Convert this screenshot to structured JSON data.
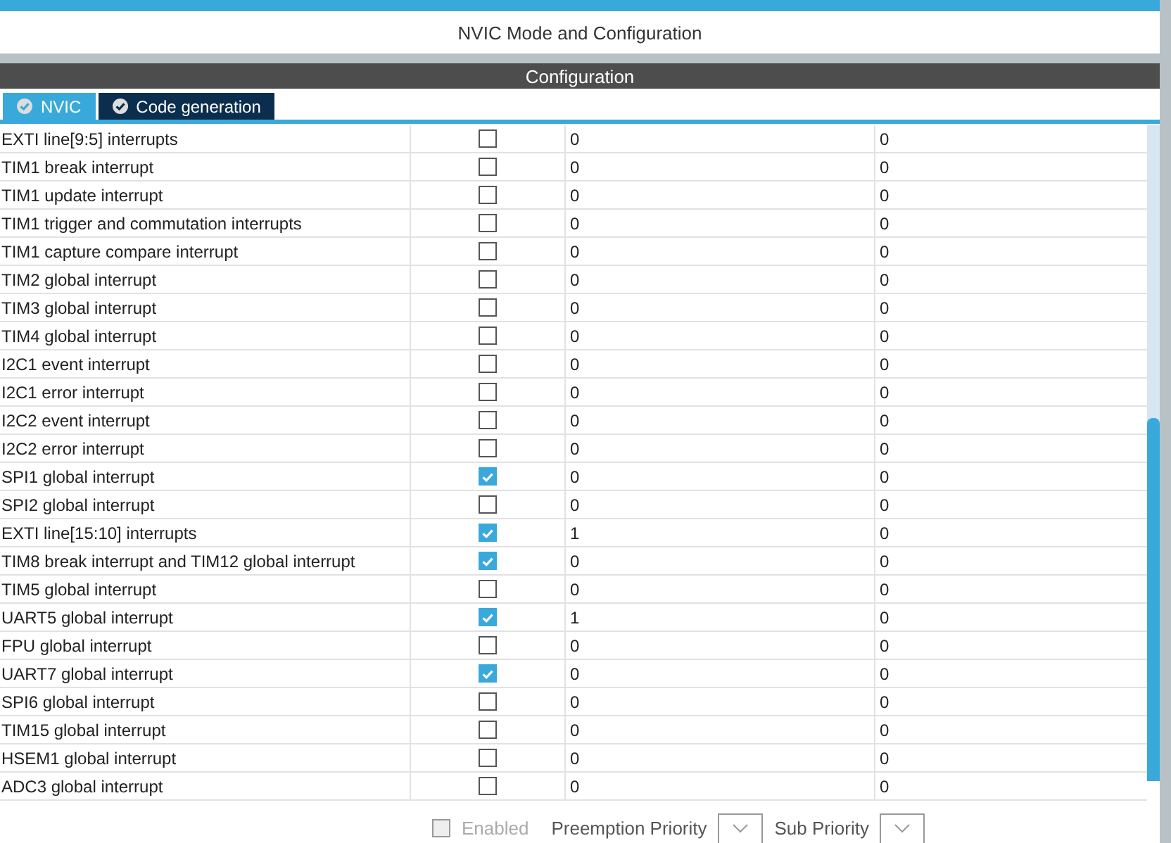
{
  "panel_title": "NVIC Mode and Configuration",
  "section_title": "Configuration",
  "tabs": [
    {
      "label": "NVIC",
      "selected": true
    },
    {
      "label": "Code generation",
      "selected": false
    }
  ],
  "rows": [
    {
      "name": "EXTI line[9:5] interrupts",
      "enabled": false,
      "preemption": "0",
      "sub": "0"
    },
    {
      "name": "TIM1 break interrupt",
      "enabled": false,
      "preemption": "0",
      "sub": "0"
    },
    {
      "name": "TIM1 update interrupt",
      "enabled": false,
      "preemption": "0",
      "sub": "0"
    },
    {
      "name": "TIM1 trigger and commutation interrupts",
      "enabled": false,
      "preemption": "0",
      "sub": "0"
    },
    {
      "name": "TIM1 capture compare interrupt",
      "enabled": false,
      "preemption": "0",
      "sub": "0"
    },
    {
      "name": "TIM2 global interrupt",
      "enabled": false,
      "preemption": "0",
      "sub": "0"
    },
    {
      "name": "TIM3 global interrupt",
      "enabled": false,
      "preemption": "0",
      "sub": "0"
    },
    {
      "name": "TIM4 global interrupt",
      "enabled": false,
      "preemption": "0",
      "sub": "0"
    },
    {
      "name": "I2C1 event interrupt",
      "enabled": false,
      "preemption": "0",
      "sub": "0"
    },
    {
      "name": "I2C1 error interrupt",
      "enabled": false,
      "preemption": "0",
      "sub": "0"
    },
    {
      "name": "I2C2 event interrupt",
      "enabled": false,
      "preemption": "0",
      "sub": "0"
    },
    {
      "name": "I2C2 error interrupt",
      "enabled": false,
      "preemption": "0",
      "sub": "0"
    },
    {
      "name": "SPI1 global interrupt",
      "enabled": true,
      "preemption": "0",
      "sub": "0"
    },
    {
      "name": "SPI2 global interrupt",
      "enabled": false,
      "preemption": "0",
      "sub": "0"
    },
    {
      "name": "EXTI line[15:10] interrupts",
      "enabled": true,
      "preemption": "1",
      "sub": "0"
    },
    {
      "name": "TIM8 break interrupt and TIM12 global interrupt",
      "enabled": true,
      "preemption": "0",
      "sub": "0"
    },
    {
      "name": "TIM5 global interrupt",
      "enabled": false,
      "preemption": "0",
      "sub": "0"
    },
    {
      "name": "UART5 global interrupt",
      "enabled": true,
      "preemption": "1",
      "sub": "0"
    },
    {
      "name": "FPU global interrupt",
      "enabled": false,
      "preemption": "0",
      "sub": "0"
    },
    {
      "name": "UART7 global interrupt",
      "enabled": true,
      "preemption": "0",
      "sub": "0"
    },
    {
      "name": "SPI6 global interrupt",
      "enabled": false,
      "preemption": "0",
      "sub": "0"
    },
    {
      "name": "TIM15 global interrupt",
      "enabled": false,
      "preemption": "0",
      "sub": "0"
    },
    {
      "name": "HSEM1 global interrupt",
      "enabled": false,
      "preemption": "0",
      "sub": "0"
    },
    {
      "name": "ADC3 global interrupt",
      "enabled": false,
      "preemption": "0",
      "sub": "0"
    }
  ],
  "footer": {
    "enabled_label": "Enabled",
    "enabled": false,
    "preemption_label": "Preemption Priority",
    "sub_label": "Sub Priority"
  }
}
